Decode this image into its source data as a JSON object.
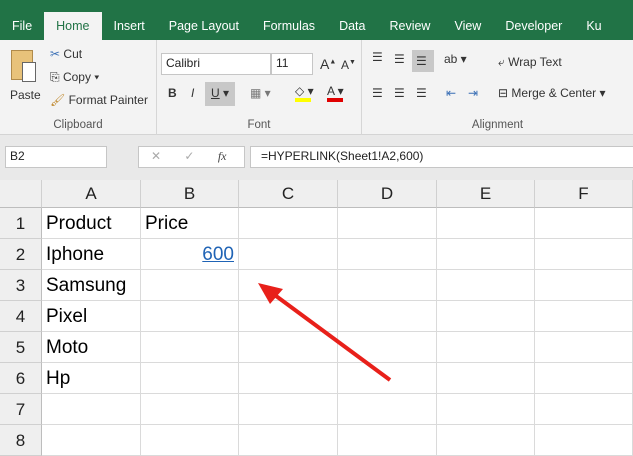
{
  "ribbon_tabs": [
    "File",
    "Home",
    "Insert",
    "Page Layout",
    "Formulas",
    "Data",
    "Review",
    "View",
    "Developer",
    "Ku"
  ],
  "active_tab": "Home",
  "clipboard": {
    "paste": "Paste",
    "cut": "Cut",
    "copy": "Copy",
    "format_painter": "Format Painter",
    "label": "Clipboard"
  },
  "font": {
    "name": "Calibri",
    "size": "11",
    "bold": "B",
    "italic": "I",
    "underline": "U",
    "label": "Font",
    "fill_color": "#ffff00",
    "font_color": "#e00000"
  },
  "alignment": {
    "wrap_text": "Wrap Text",
    "merge_center": "Merge & Center",
    "label": "Alignment"
  },
  "name_box": "B2",
  "fx": "fx",
  "formula": "=HYPERLINK(Sheet1!A2,600)",
  "columns": [
    "A",
    "B",
    "C",
    "D",
    "E",
    "F"
  ],
  "rows": [
    {
      "num": "1",
      "A": "Product",
      "B": "Price"
    },
    {
      "num": "2",
      "A": "Iphone",
      "B": "600"
    },
    {
      "num": "3",
      "A": "Samsung",
      "B": ""
    },
    {
      "num": "4",
      "A": "Pixel",
      "B": ""
    },
    {
      "num": "5",
      "A": "Moto",
      "B": ""
    },
    {
      "num": "6",
      "A": "Hp",
      "B": ""
    },
    {
      "num": "7",
      "A": "",
      "B": ""
    },
    {
      "num": "8",
      "A": "",
      "B": ""
    }
  ]
}
